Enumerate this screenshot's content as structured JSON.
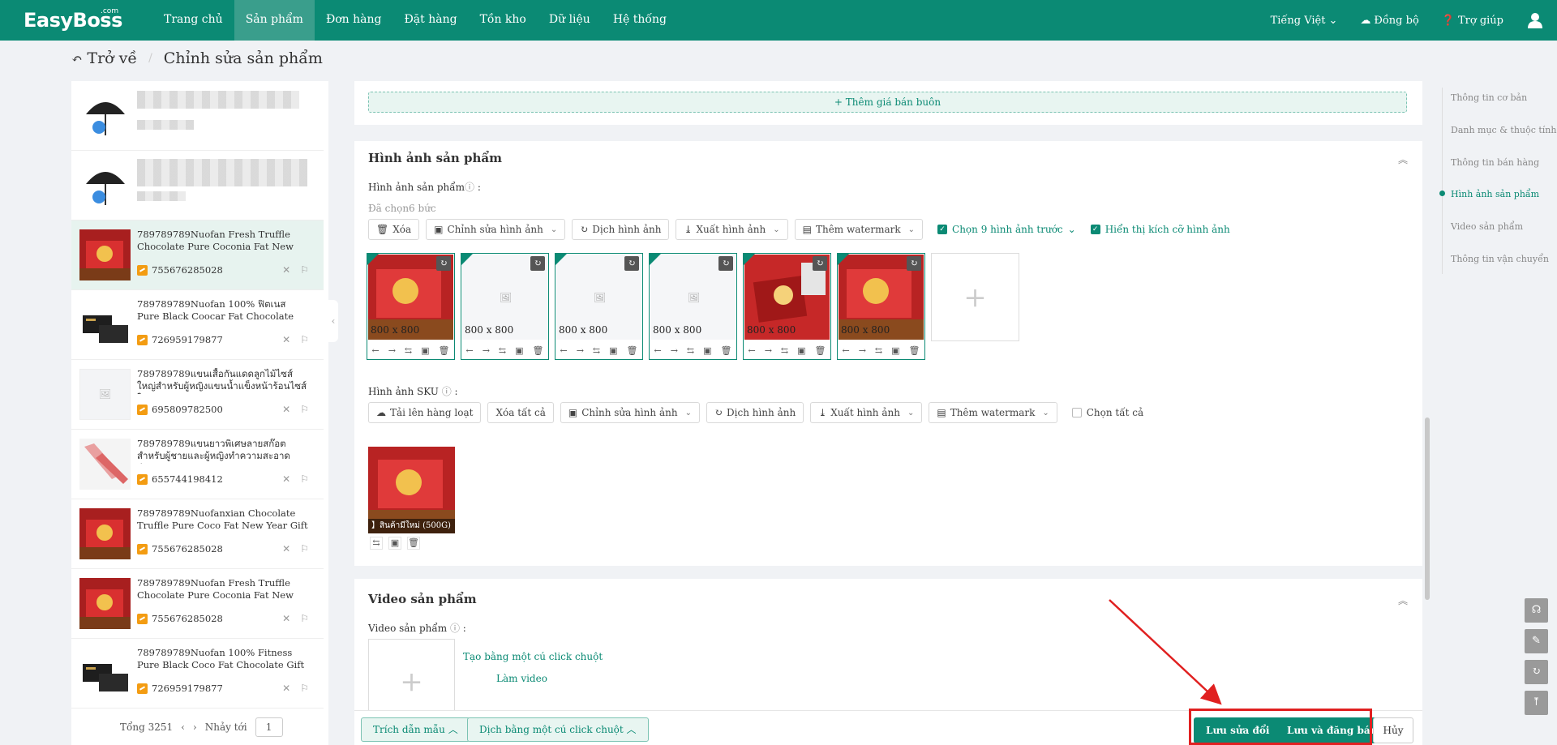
{
  "header": {
    "logo": "EasyBoss",
    "logo_suffix": ".com",
    "nav": [
      "Trang chủ",
      "Sản phẩm",
      "Đơn hàng",
      "Đặt hàng",
      "Tồn kho",
      "Dữ liệu",
      "Hệ thống"
    ],
    "active_nav": "Sản phẩm",
    "language": "Tiếng Việt",
    "sync": "Đồng bộ",
    "help": "Trợ giúp"
  },
  "breadcrumb": {
    "back": "Trở về",
    "title": "Chỉnh sửa sản phẩm"
  },
  "product_list": {
    "items": [
      {
        "title": "789789789Nuofan Fresh Truffle Chocolate Pure Coconia Fat New Year Gift Box Cand...",
        "id": "755676285028",
        "selected": true,
        "thumb": "red-gift-box"
      },
      {
        "title": "789789789Nuofan 100% ฟิตเนส Pure Black Coocar Fat Chocolate Gift Box ขายส่งขน...",
        "id": "726959179877",
        "thumb": "black-box"
      },
      {
        "title": "789789789แขนเสื้อกันแดดลูกไม้ไซส์ใหญ่สำหรับผู้หญิงแขนน้ำแข็งหน้าร้อนไซส์ใหญ่...",
        "id": "695809782500",
        "thumb": "placeholder"
      },
      {
        "title": "789789789แขนยาวพิเศษลายสก๊อตสำหรับผู้ชายและผู้หญิงทำความสะอาดสำนักงาน...",
        "id": "655744198412",
        "thumb": "sleeve"
      },
      {
        "title": "789789789Nuofanxian Chocolate Truffle Pure Coco Fat New Year Gift Box Candy ...",
        "id": "755676285028",
        "thumb": "red-gift-box"
      },
      {
        "title": "789789789Nuofan Fresh Truffle Chocolate Pure Coconia Fat New Year Gift Box Cand...",
        "id": "755676285028",
        "thumb": "red-gift-box"
      },
      {
        "title": "789789789Nuofan 100% Fitness Pure Black Coco Fat Chocolate Gift Box Wholesale ...",
        "id": "726959179877",
        "thumb": "black-box"
      }
    ],
    "pager": {
      "total": "Tổng 3251",
      "goto": "Nhảy tới",
      "page": "1"
    }
  },
  "wholesale": {
    "add_label": "Thêm giá bán buôn"
  },
  "product_images": {
    "section_title": "Hình ảnh sản phẩm",
    "field_label": "Hình ảnh sản phẩm",
    "selected_count": "Đã chọn6 bức",
    "toolbar": {
      "delete": "Xóa",
      "edit": "Chỉnh sửa hình ảnh",
      "translate": "Dịch hình ảnh",
      "export": "Xuất hình ảnh",
      "watermark": "Thêm watermark",
      "choose9": "Chọn 9 hình ảnh trước",
      "show_size": "Hiển thị kích cỡ hình ảnh"
    },
    "tiles": [
      {
        "size": "800 x 800",
        "kind": "photo"
      },
      {
        "size": "800 x 800",
        "kind": "placeholder"
      },
      {
        "size": "800 x 800",
        "kind": "placeholder"
      },
      {
        "size": "800 x 800",
        "kind": "placeholder"
      },
      {
        "size": "800 x 800",
        "kind": "photo2"
      },
      {
        "size": "800 x 800",
        "kind": "photo"
      }
    ]
  },
  "sku_images": {
    "field_label": "Hình ảnh SKU",
    "toolbar": {
      "upload": "Tải lên hàng loạt",
      "delete_all": "Xóa tất cả",
      "edit": "Chỉnh sửa hình ảnh",
      "translate": "Dịch hình ảnh",
      "export": "Xuất hình ảnh",
      "watermark": "Thêm watermark",
      "select_all": "Chọn tất cả"
    },
    "caption": "】สินค้ามีใหม่ (500G)"
  },
  "video": {
    "section_title": "Video sản phẩm",
    "field_label": "Video sản phẩm",
    "one_click": "Tạo bằng một cú click chuột",
    "make": "Làm video"
  },
  "right_nav": {
    "items": [
      "Thông tin cơ bản",
      "Danh mục & thuộc tính",
      "Thông tin bán hàng",
      "Hình ảnh sản phẩm",
      "Video sản phẩm",
      "Thông tin vận chuyển"
    ],
    "active": "Hình ảnh sản phẩm"
  },
  "footer": {
    "template": "Trích dẫn mẫu",
    "translate": "Dịch bằng một cú click chuột",
    "save": "Lưu sửa đổi",
    "save_publish": "Lưu và đăng bán",
    "cancel": "Hủy"
  },
  "colors": {
    "brand": "#0b8a74",
    "highlight": "#e02020"
  }
}
